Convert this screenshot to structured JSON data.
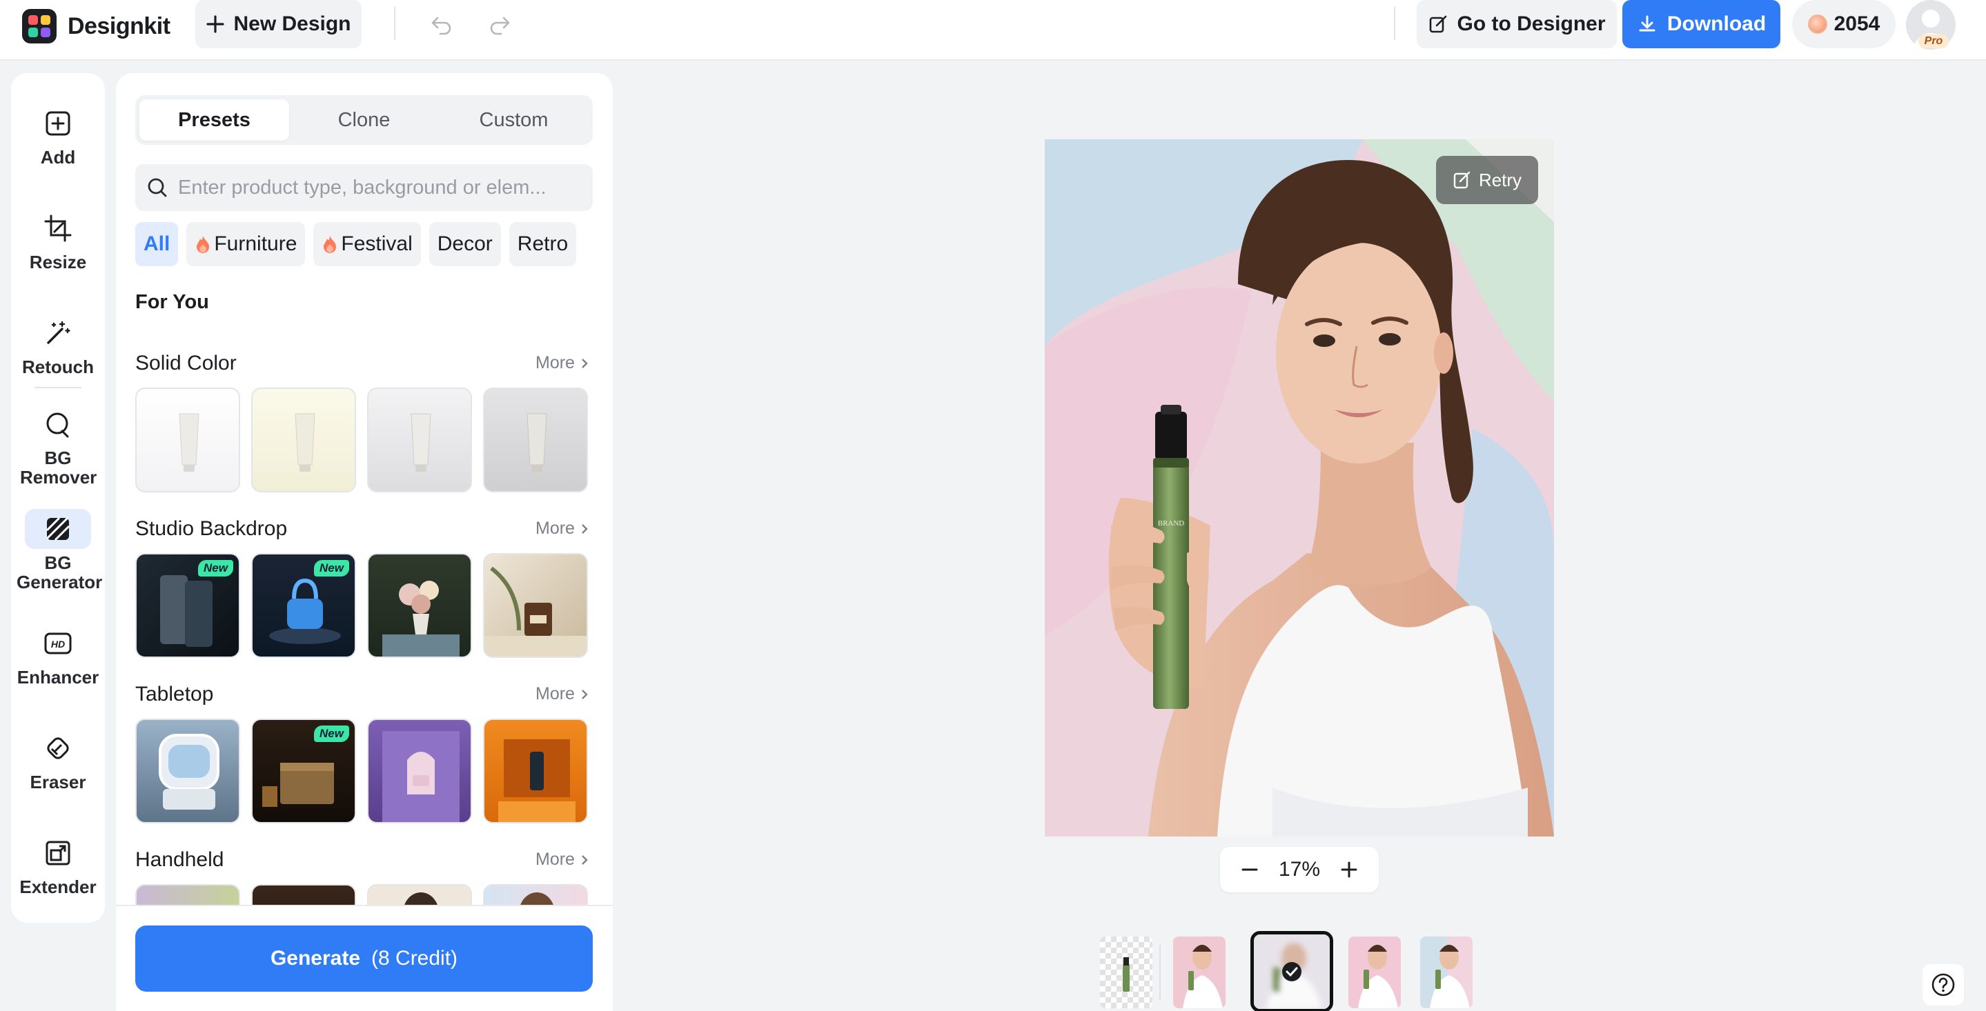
{
  "app": {
    "name": "Designkit"
  },
  "toolbar": {
    "new_design": "New Design",
    "go_to_designer": "Go to Designer",
    "download": "Download",
    "credits": "2054",
    "pro_badge": "Pro"
  },
  "tools": [
    {
      "label": "Add",
      "icon": "add-square-icon"
    },
    {
      "label": "Resize",
      "icon": "crop-icon"
    },
    {
      "label": "Retouch",
      "icon": "magic-wand-icon"
    },
    {
      "label": "BG Remover",
      "icon": "bg-remover-icon"
    },
    {
      "label": "BG Generator",
      "icon": "bg-generator-icon",
      "active": true
    },
    {
      "label": "Enhancer",
      "icon": "hd-icon"
    },
    {
      "label": "Eraser",
      "icon": "eraser-icon"
    },
    {
      "label": "Extender",
      "icon": "extend-icon"
    }
  ],
  "panel": {
    "tabs": [
      {
        "label": "Presets",
        "active": true
      },
      {
        "label": "Clone",
        "active": false
      },
      {
        "label": "Custom",
        "active": false
      }
    ],
    "search_placeholder": "Enter product type, background or elem...",
    "chips": [
      {
        "label": "All",
        "active": true,
        "hot": false
      },
      {
        "label": "Furniture",
        "active": false,
        "hot": true
      },
      {
        "label": "Festival",
        "active": false,
        "hot": true
      },
      {
        "label": "Decor",
        "active": false,
        "hot": false
      },
      {
        "label": "Retro",
        "active": false,
        "hot": false
      }
    ],
    "for_you": "For You",
    "more": "More",
    "new_tag": "New",
    "sections": [
      {
        "title": "Solid Color",
        "new_flags": [
          false,
          false,
          false,
          false
        ]
      },
      {
        "title": "Studio Backdrop",
        "new_flags": [
          true,
          true,
          false,
          false
        ]
      },
      {
        "title": "Tabletop",
        "new_flags": [
          false,
          true,
          false,
          false
        ]
      },
      {
        "title": "Handheld",
        "new_flags": [
          false,
          false,
          false,
          false
        ]
      }
    ],
    "generate_label": "Generate",
    "generate_credit": "(8 Credit)"
  },
  "canvas": {
    "retry": "Retry",
    "zoom": "17%",
    "brand_text": "BRAND"
  },
  "colors": {
    "accent": "#2f7cf6",
    "new_tag": "#3ce6a6",
    "bottle": "#6f8f4f"
  }
}
